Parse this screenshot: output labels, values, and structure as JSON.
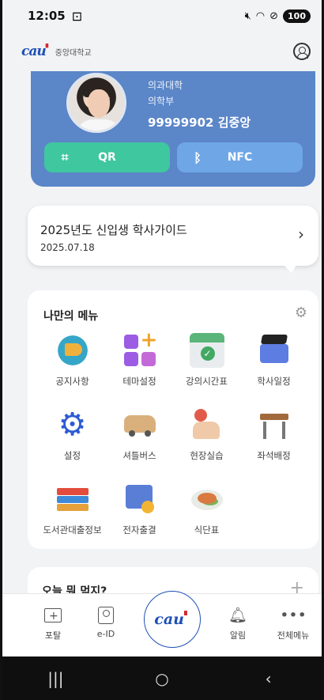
{
  "status": {
    "time": "12:05",
    "battery": "100"
  },
  "header": {
    "logo_mark": "cau",
    "university": "중앙대학교"
  },
  "idcard": {
    "college": "의과대학",
    "department": "의학부",
    "id_and_name": "99999902 김중앙",
    "qr_label": "QR",
    "nfc_label": "NFC"
  },
  "notice": {
    "title": "2025년도 신입생 학사가이드",
    "date": "2025.07.18"
  },
  "my_menu": {
    "title": "나만의 메뉴",
    "items": [
      {
        "label": "공지사항",
        "icon": "megaphone-icon"
      },
      {
        "label": "테마설정",
        "icon": "theme-plus-icon"
      },
      {
        "label": "강의시간표",
        "icon": "calendar-check-icon"
      },
      {
        "label": "학사일정",
        "icon": "graduation-cap-icon"
      },
      {
        "label": "설정",
        "icon": "gear-icon"
      },
      {
        "label": "셔틀버스",
        "icon": "bus-icon"
      },
      {
        "label": "현장실습",
        "icon": "thumbs-up-icon"
      },
      {
        "label": "좌석배정",
        "icon": "desk-icon"
      },
      {
        "label": "도서관대출정보",
        "icon": "books-icon"
      },
      {
        "label": "전자출결",
        "icon": "attendance-calendar-icon"
      },
      {
        "label": "식단표",
        "icon": "meal-bowl-icon"
      }
    ]
  },
  "today": {
    "title": "오늘 뭐 먹지?",
    "add": "+"
  },
  "bottom_nav": {
    "portal": "포탈",
    "eid": "e-ID",
    "center_logo": "cau",
    "alarm": "알림",
    "all_menu": "전체메뉴"
  },
  "colors": {
    "card_blue": "#5b86c8",
    "qr_green": "#3fc79f",
    "nfc_blue": "#6fa7e6",
    "brand_blue": "#1e50b4"
  }
}
